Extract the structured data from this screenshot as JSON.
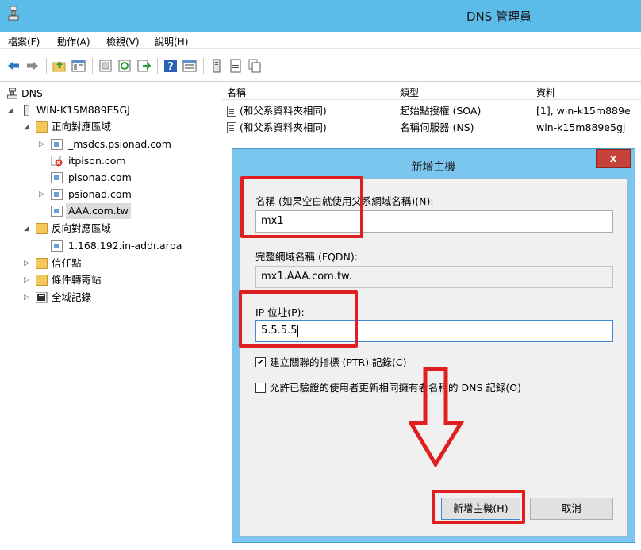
{
  "window": {
    "title": "DNS 管理員"
  },
  "menu": [
    "檔案(F)",
    "動作(A)",
    "檢視(V)",
    "說明(H)"
  ],
  "toolbar": [
    "back-icon",
    "forward-icon",
    "up-folder-icon",
    "show-tree-icon",
    "properties-icon",
    "refresh-icon",
    "export-icon",
    "help-icon",
    "console-view-icon",
    "server-icon",
    "list-icon",
    "copy-icon"
  ],
  "tree": {
    "root": "DNS",
    "server": "WIN-K15M889E5GJ",
    "forward_zones": "正向對應區域",
    "zones": [
      "_msdcs.psionad.com",
      "itpison.com",
      "pisonad.com",
      "psionad.com",
      "AAA.com.tw"
    ],
    "reverse_zones": "反向對應區域",
    "reverse_zone": "1.168.192.in-addr.arpa",
    "trust_points": "信任點",
    "conditional_forwarders": "條件轉寄站",
    "global_logs": "全域記錄"
  },
  "list": {
    "headers": [
      "名稱",
      "類型",
      "資料"
    ],
    "rows": [
      [
        "(和父系資料夾相同)",
        "起始點授權 (SOA)",
        "[1], win-k15m889e"
      ],
      [
        "(和父系資料夾相同)",
        "名稱伺服器 (NS)",
        "win-k15m889e5gj"
      ]
    ]
  },
  "dialog": {
    "title": "新增主機",
    "close": "x",
    "name_label": "名稱 (如果空白就使用父系網域名稱)(N):",
    "name_value": "mx1",
    "fqdn_label": "完整網域名稱 (FQDN):",
    "fqdn_value": "mx1.AAA.com.tw.",
    "ip_label": "IP 位址(P):",
    "ip_value": "5.5.5.5",
    "ptr_check": "✔",
    "ptr_label": "建立關聯的指標 (PTR) 記錄(C)",
    "auth_label": "允許已驗證的使用者更新相同擁有者名稱的 DNS 記錄(O)",
    "add_button": "新增主機(H)",
    "cancel_button": "取消"
  },
  "colors": {
    "titlebar": "#5bbce9",
    "dialog_frame": "#7ac6ee",
    "highlight": "#e02020",
    "close": "#c7423a"
  }
}
